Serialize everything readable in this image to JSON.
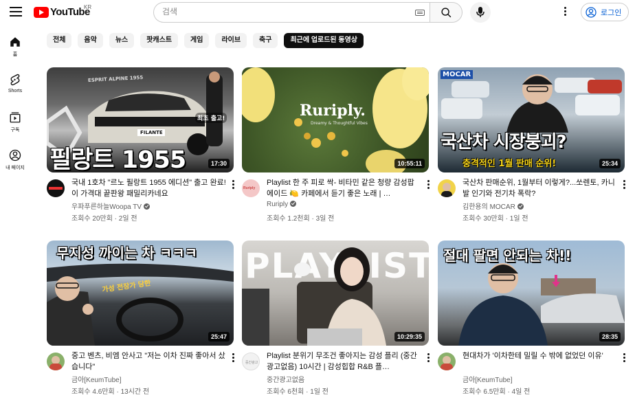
{
  "header": {
    "logo_text": "YouTube",
    "region": "KR",
    "search_placeholder": "검색",
    "signin_label": "로그인"
  },
  "sidebar": {
    "items": [
      {
        "label": "홈",
        "icon": "home-icon"
      },
      {
        "label": "Shorts",
        "icon": "shorts-icon"
      },
      {
        "label": "구독",
        "icon": "subscriptions-icon"
      },
      {
        "label": "내 페이지",
        "icon": "account-icon"
      }
    ]
  },
  "chips": [
    "전체",
    "음악",
    "뉴스",
    "팟캐스트",
    "게임",
    "라이브",
    "축구",
    "최근에 업로드된 동영상"
  ],
  "videos": [
    {
      "title": "국내 1호차 \"르노 필랑트 1955 에디션\" 출고 완료! 이 가격대 끝판왕 패밀리카네요",
      "channel": "우파푸른하늘Woopa TV",
      "verified": true,
      "meta": "조회수 20만회 · 2일 전",
      "duration": "17:30",
      "thumb_text": "필랑트 1955",
      "thumb_sub": "ESPRIT ALPINE 1955",
      "thumb_plate": "FILANTE",
      "thumb_bubble": "최초 출고!"
    },
    {
      "title": "Playlist 한 주 피로 싹- 비타민 같은 청량 감성팝 에이드 🍋 카페에서 듣기 좋은 노래 | …",
      "channel": "Ruriply",
      "verified": true,
      "meta": "조회수 1.2천회 · 3일 전",
      "duration": "10:55:11",
      "thumb_text": "Ruriply.",
      "thumb_sub": "Dreamy & Thoughtful Vibes"
    },
    {
      "title": "국산차 판매순위, 1월부터 이렇게?...쏘렌토, 카니발 인기와 전기차 폭락?",
      "channel": "김한용의 MOCAR",
      "verified": true,
      "meta": "조회수 30만회 · 1일 전",
      "duration": "25:34",
      "thumb_text": "국산차 시장붕괴?",
      "thumb_sub": "충격적인 1월 판매 순위!",
      "thumb_logo": "MOCAR"
    },
    {
      "title": "중고 벤츠, 비엠 안사고 \"저는 이차 진짜 좋아서 샀습니다\"",
      "channel": "금아[KeumTube]",
      "verified": false,
      "meta": "조회수 4.6만회 · 13시간 전",
      "duration": "25:47",
      "thumb_text": "무지성 까이는 차 ㅋㅋㅋ",
      "thumb_sub": "가성 전장가 당한 "
    },
    {
      "title": "Playlist 분위기 무조건 좋아지는 감성 플리 (중간광고없음) 10시간 | 감성힙합 R&B 플…",
      "channel": "중간광고없음",
      "verified": false,
      "meta": "조회수 6천회 · 1일 전",
      "duration": "10:29:35",
      "thumb_text": "PLAYLIST"
    },
    {
      "title": "현대차가 '이차한테 밀릴 수 밖에 없었던 이유'",
      "channel": "금아[KeumTube]",
      "verified": false,
      "meta": "조회수 6.5만회 · 4일 전",
      "duration": "28:35",
      "thumb_text": "절대 팔면 안되는 차!!"
    }
  ],
  "colors": {
    "brand_red": "#ff0000",
    "link_blue": "#065fd4",
    "text_secondary": "#606060",
    "chip_bg": "#f2f2f2"
  }
}
